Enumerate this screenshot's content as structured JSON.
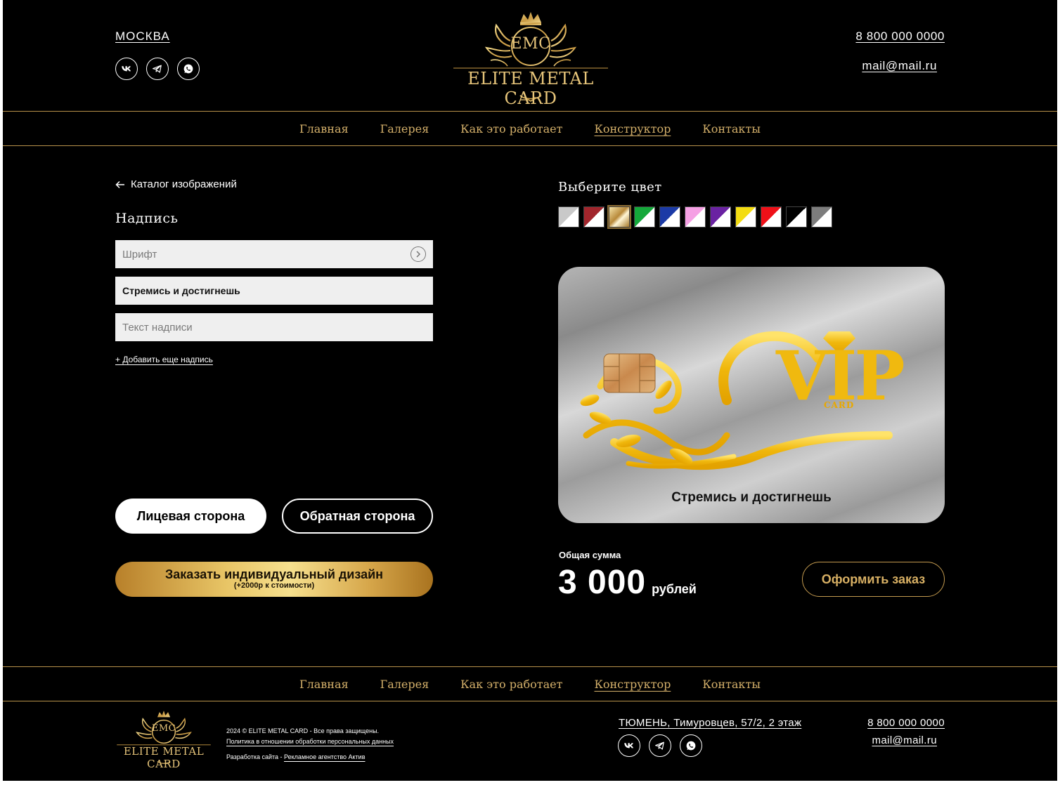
{
  "header": {
    "city": "МОСКВА",
    "phone": "8 800 000 0000",
    "email": "mail@mail.ru",
    "logo_text": "ELITE METAL CARD",
    "logo_monogram": "EMC",
    "social": [
      "vk-icon",
      "telegram-icon",
      "whatsapp-icon"
    ]
  },
  "nav": {
    "items": [
      "Главная",
      "Галерея",
      "Как это работает",
      "Конструктор",
      "Контакты"
    ],
    "active": "Конструктор"
  },
  "editor": {
    "back_label": "Каталог изображений",
    "section_title": "Надпись",
    "font_placeholder": "Шрифт",
    "inscription_value": "Стремись и достигнешь",
    "text_placeholder": "Текст надписи",
    "add_more": "+  Добавить еще надпись",
    "front_side": "Лицевая сторона",
    "back_side": "Обратная сторона",
    "custom_design": "Заказать индивидуальный дизайн",
    "custom_design_note": "(+2000р к стоимости)"
  },
  "preview": {
    "color_title": "Выберите цвет",
    "colors": [
      {
        "name": "silver",
        "color": "#c9c9c9"
      },
      {
        "name": "red",
        "color": "#a1252c"
      },
      {
        "name": "gold",
        "color": "#c9a048"
      },
      {
        "name": "green",
        "color": "#14a83a"
      },
      {
        "name": "blue",
        "color": "#1b3aa6"
      },
      {
        "name": "pink",
        "color": "#f5a0e4"
      },
      {
        "name": "purple",
        "color": "#6a22a2"
      },
      {
        "name": "yellow",
        "color": "#f3dc12"
      },
      {
        "name": "bright-red",
        "color": "#ef1018"
      },
      {
        "name": "black",
        "color": "#000000"
      },
      {
        "name": "gray",
        "color": "#7d7d7d"
      }
    ],
    "selected_color": "gold",
    "card_text": "Стремись и достигнешь",
    "card_logo": "VIP",
    "card_logo_sub": "CARD",
    "total_label": "Общая сумма",
    "total_value": "3 000",
    "currency": "рублей",
    "order_button": "Оформить заказ"
  },
  "footer": {
    "copyright": "2024 © ELITE METAL CARD - Все права защищены.",
    "policy": "Политика в отношении обработки персональных данных",
    "dev_prefix": "Разработка сайта - ",
    "dev_link": "Рекламное агентство Актив",
    "address": "ТЮМЕНЬ, Тимуровцев, 57/2, 2 этаж",
    "phone": "8 800 000 0000",
    "email": "mail@mail.ru"
  },
  "colors": {
    "gold": "#d4b06a",
    "accent_border": "#b8924a",
    "background": "#000000"
  }
}
